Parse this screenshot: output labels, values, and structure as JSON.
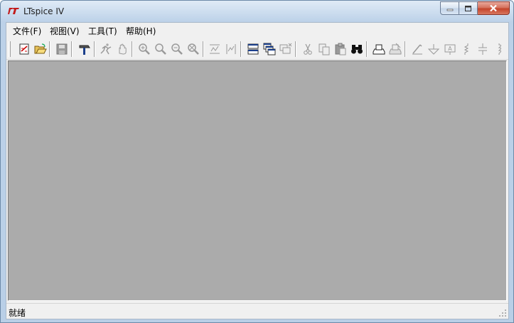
{
  "window": {
    "title": "LTspice IV",
    "app_icon": "linear-technology-logo",
    "controls": {
      "minimize": "minimize-icon",
      "maximize": "maximize-icon",
      "close": "close-icon"
    }
  },
  "menu": {
    "items": [
      {
        "label": "文件(F)"
      },
      {
        "label": "视图(V)"
      },
      {
        "label": "工具(T)"
      },
      {
        "label": "帮助(H)"
      }
    ]
  },
  "toolbar": {
    "buttons": [
      {
        "icon": "new-schematic-icon",
        "enabled": true
      },
      {
        "icon": "open-folder-icon",
        "enabled": true
      },
      {
        "icon": "save-icon",
        "enabled": false
      },
      {
        "icon": "control-panel-hammer-icon",
        "enabled": true
      },
      {
        "icon": "run-icon",
        "enabled": false
      },
      {
        "icon": "pan-hand-icon",
        "enabled": false
      },
      {
        "icon": "zoom-in-icon",
        "enabled": false
      },
      {
        "icon": "zoom-area-icon",
        "enabled": false
      },
      {
        "icon": "zoom-out-icon",
        "enabled": false
      },
      {
        "icon": "zoom-fit-icon",
        "enabled": false
      },
      {
        "icon": "autorange-y-icon",
        "enabled": false
      },
      {
        "icon": "autorange-x-icon",
        "enabled": false
      },
      {
        "icon": "tile-horizontal-icon",
        "enabled": true
      },
      {
        "icon": "cascade-windows-icon",
        "enabled": true
      },
      {
        "icon": "close-all-windows-icon",
        "enabled": false
      },
      {
        "icon": "cut-icon",
        "enabled": false
      },
      {
        "icon": "copy-icon",
        "enabled": false
      },
      {
        "icon": "paste-icon",
        "enabled": false
      },
      {
        "icon": "find-binoculars-icon",
        "enabled": true
      },
      {
        "icon": "print-preview-icon",
        "enabled": true
      },
      {
        "icon": "print-icon",
        "enabled": false
      },
      {
        "icon": "draw-wire-icon",
        "enabled": false
      },
      {
        "icon": "ground-icon",
        "enabled": false
      },
      {
        "icon": "label-net-icon",
        "enabled": false
      },
      {
        "icon": "resistor-icon",
        "enabled": false
      },
      {
        "icon": "capacitor-icon",
        "enabled": false
      },
      {
        "icon": "inductor-icon",
        "enabled": false
      }
    ]
  },
  "workspace": {
    "background": "#ababab"
  },
  "statusbar": {
    "text": "就绪"
  },
  "colors": {
    "frame": "#bcd1e8",
    "close_button": "#c4442b",
    "workspace": "#ababab",
    "chrome": "#f0f0f0"
  }
}
